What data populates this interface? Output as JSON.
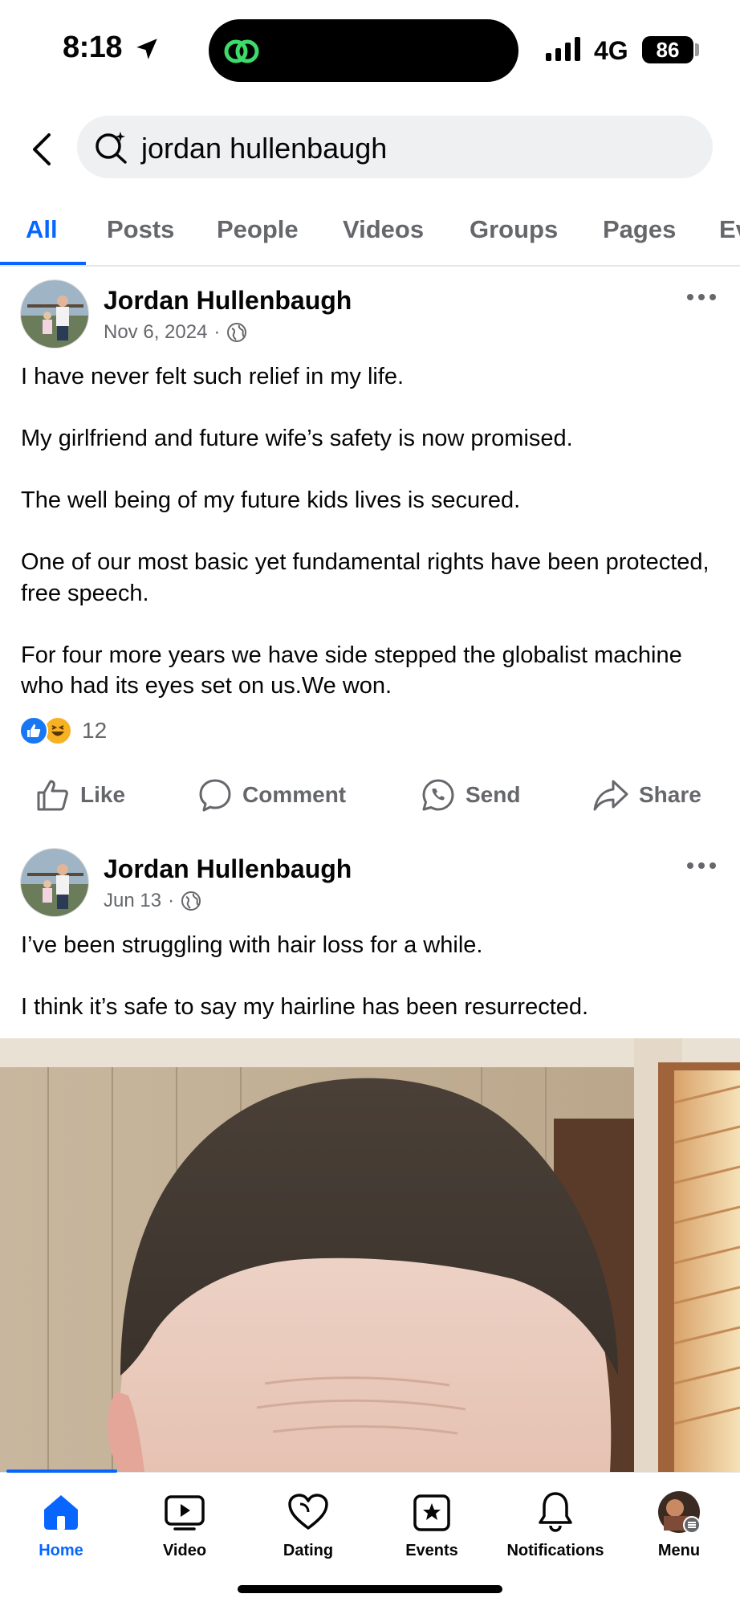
{
  "status_bar": {
    "time": "8:18",
    "network": "4G",
    "battery": "86"
  },
  "search": {
    "query": "jordan hullenbaugh"
  },
  "tabs": [
    {
      "label": "All",
      "active": true
    },
    {
      "label": "Posts"
    },
    {
      "label": "People"
    },
    {
      "label": "Videos"
    },
    {
      "label": "Groups"
    },
    {
      "label": "Pages"
    },
    {
      "label": "Ev"
    }
  ],
  "posts": [
    {
      "author": "Jordan Hullenbaugh",
      "date": "Nov 6, 2024",
      "visibility_icon": "globe-icon",
      "text": "I have never felt such relief in my life.\n\nMy girlfriend and future wife’s safety is now promised.\n\nThe well being of my future kids lives is secured.\n\nOne of our most basic yet fundamental rights have been protected, free speech.\n\nFor four more years we have side stepped the globalist machine who had its eyes set on us.We won.",
      "reaction_count": "12",
      "actions": {
        "like": "Like",
        "comment": "Comment",
        "send": "Send",
        "share": "Share"
      }
    },
    {
      "author": "Jordan Hullenbaugh",
      "date": "Jun 13",
      "visibility_icon": "globe-icon",
      "text": "I’ve been struggling with hair loss for a while.\n\nI think it’s safe to say my hairline has been resurrected."
    }
  ],
  "bottom_nav": [
    {
      "label": "Home",
      "icon": "home-icon",
      "active": true
    },
    {
      "label": "Video",
      "icon": "video-icon"
    },
    {
      "label": "Dating",
      "icon": "dating-heart-icon"
    },
    {
      "label": "Events",
      "icon": "events-star-icon"
    },
    {
      "label": "Notifications",
      "icon": "bell-icon"
    },
    {
      "label": "Menu",
      "icon": "profile-avatar"
    }
  ],
  "colors": {
    "accent": "#0866ff",
    "secondary_text": "#65676b",
    "search_bg": "#eff0f2"
  }
}
